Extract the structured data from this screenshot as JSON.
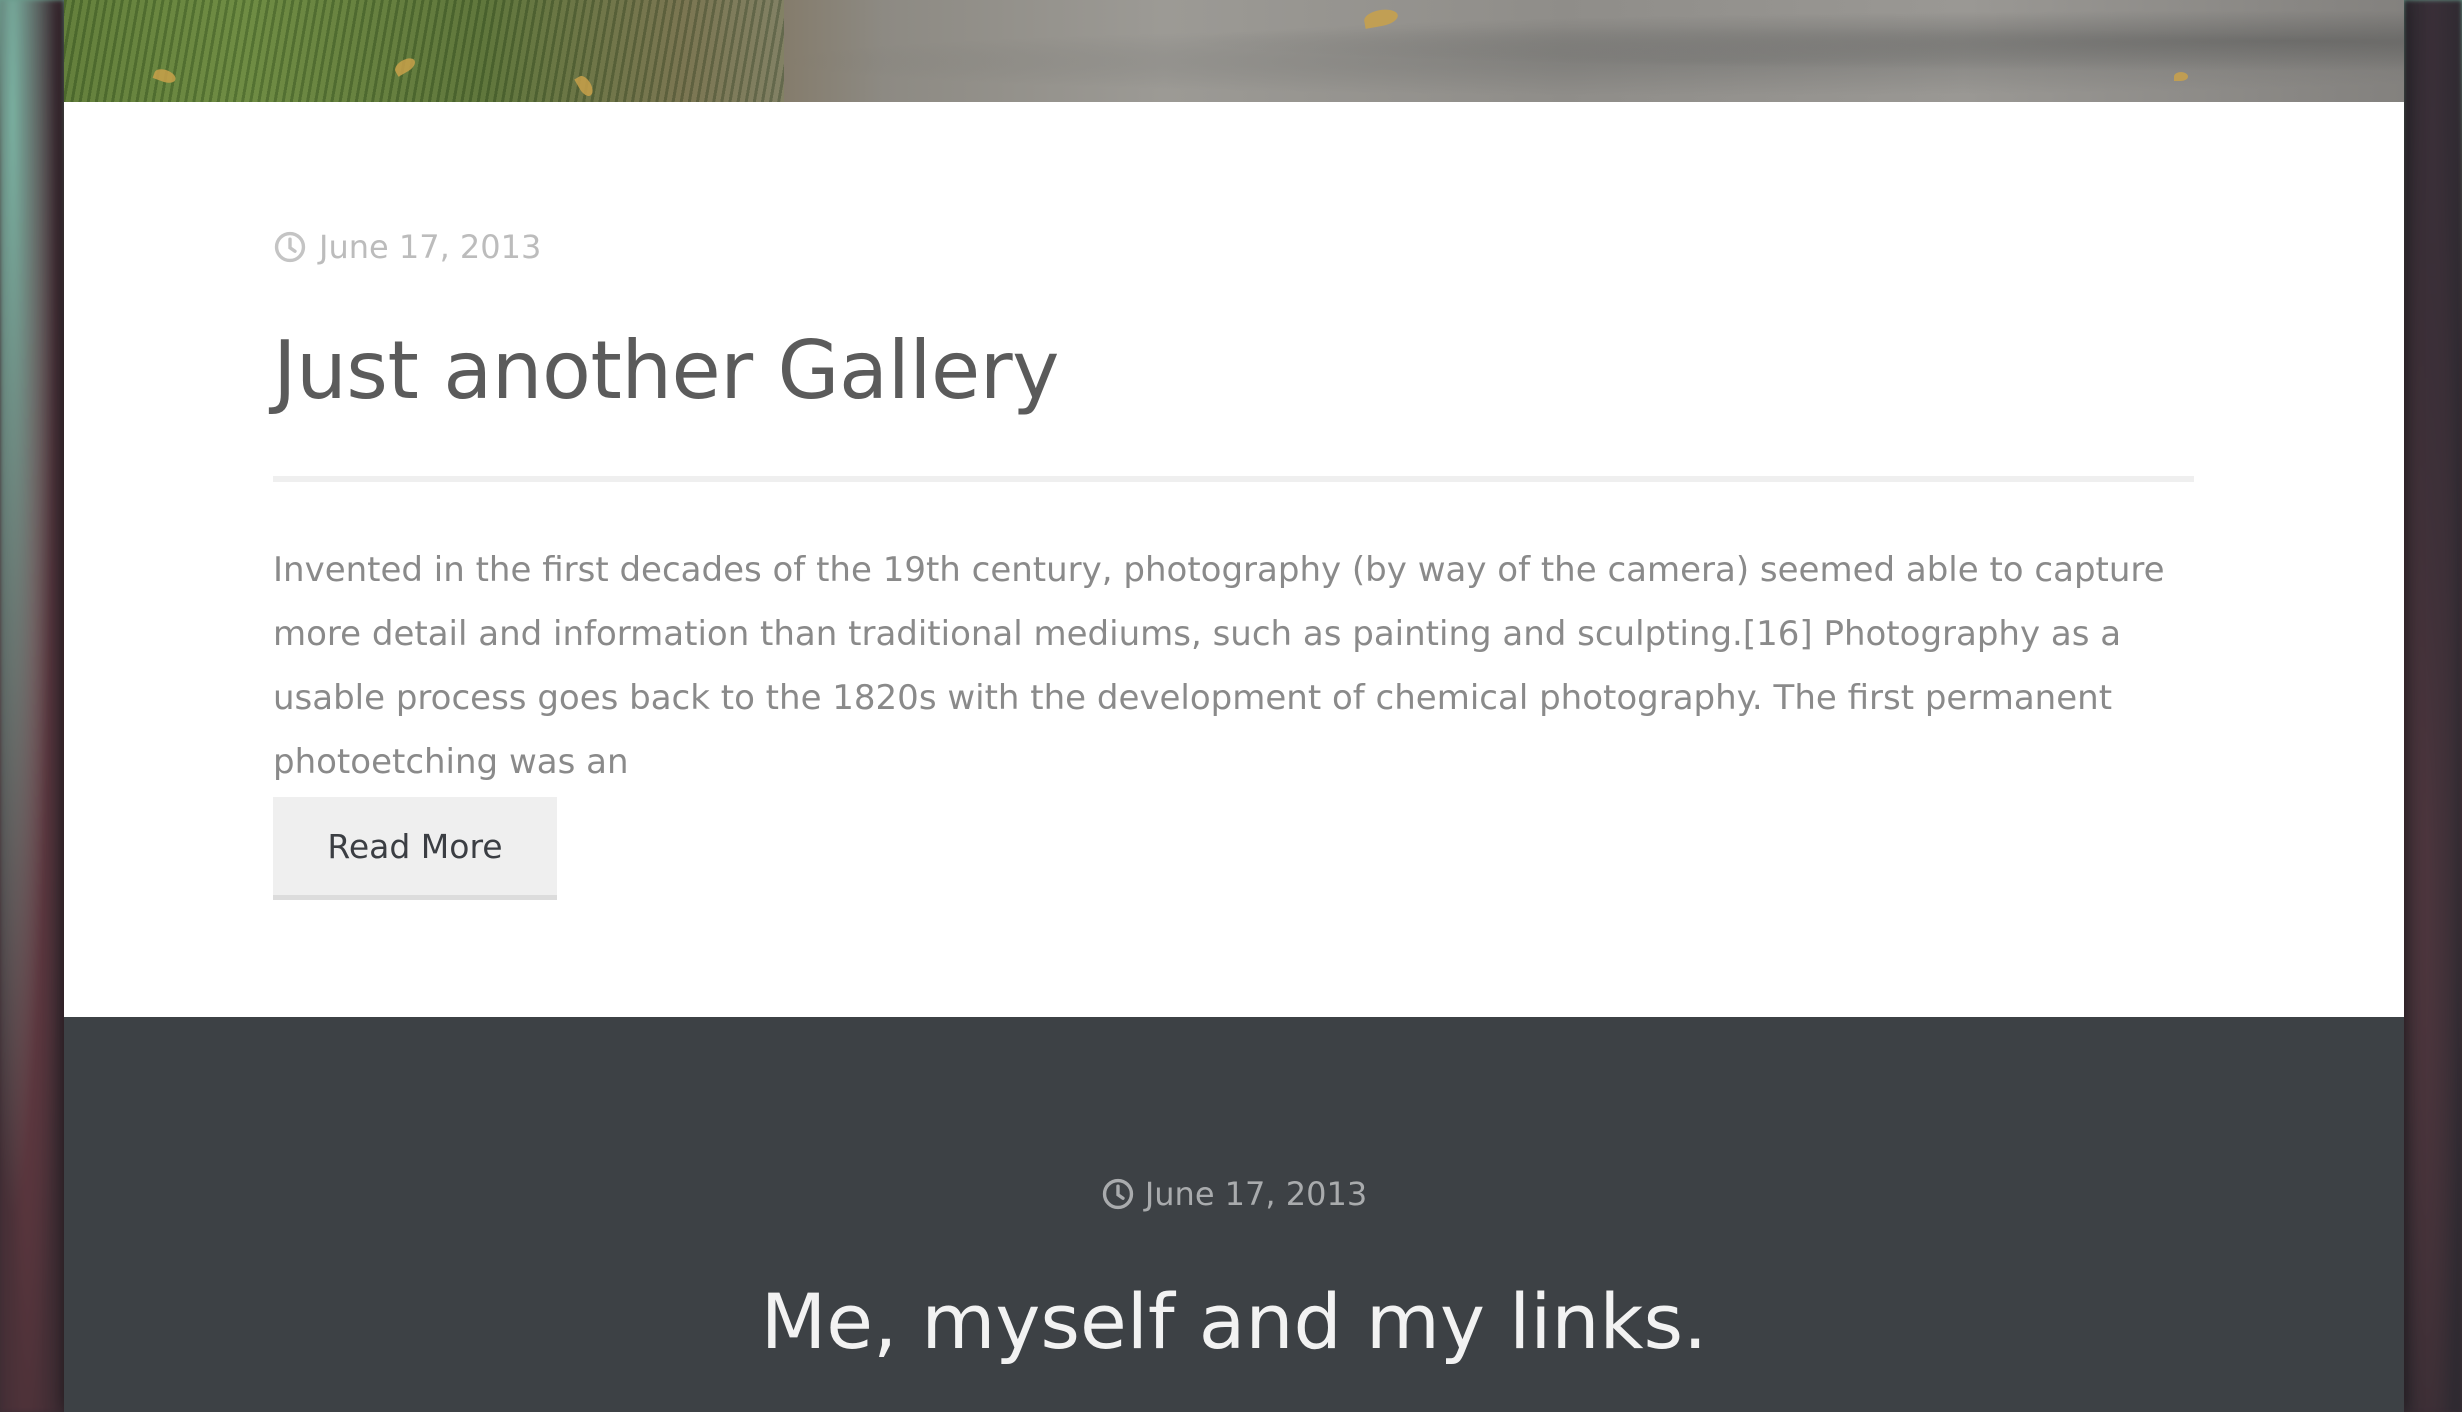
{
  "posts": [
    {
      "date": "June 17, 2013",
      "title": "Just another Gallery",
      "excerpt": "Invented in the first decades of the 19th century, photography (by way of the camera) seemed able to capture more detail and information than traditional mediums, such as painting and sculpting.[16] Photography as a usable process goes back to the 1820s with the development of chemical photography. The first permanent photoetching was an",
      "read_more_label": "Read More"
    },
    {
      "date": "June 17, 2013",
      "title": "Me, myself and my links."
    }
  ],
  "icons": {
    "date": "clock-icon"
  },
  "colors": {
    "dark_section_bg": "#3d4145",
    "light_section_bg": "#ffffff",
    "button_bg": "#efefef"
  }
}
